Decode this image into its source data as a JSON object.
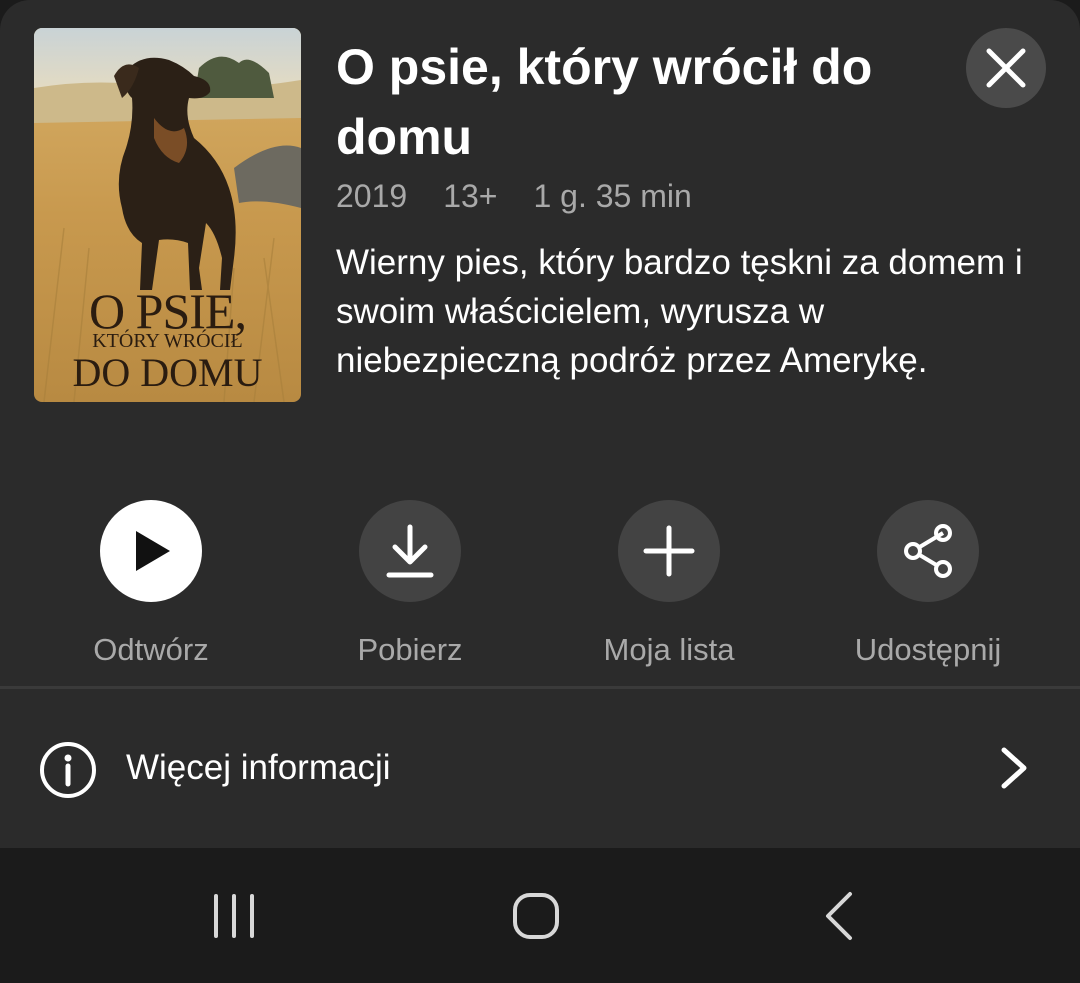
{
  "poster": {
    "line1": "O PSIE,",
    "line2": "KTÓRY WRÓCIŁ",
    "line3": "DO DOMU"
  },
  "title": "O psie, który wrócił do domu",
  "meta": {
    "year": "2019",
    "rating": "13+",
    "duration": "1 g. 35 min"
  },
  "description": "Wierny pies, który bardzo tęskni za domem i swoim właścicielem, wyrusza w niebezpieczną podróż przez Amerykę.",
  "actions": [
    {
      "label": "Odtwórz",
      "icon": "play-icon"
    },
    {
      "label": "Pobierz",
      "icon": "download-icon"
    },
    {
      "label": "Moja lista",
      "icon": "plus-icon"
    },
    {
      "label": "Udostępnij",
      "icon": "share-icon"
    }
  ],
  "more_info": {
    "label": "Więcej informacji",
    "icon": "info-icon"
  },
  "colors": {
    "sheet_bg": "#2b2b2b",
    "nav_bg": "#1b1b1b",
    "button_bg": "#434343",
    "secondary_text": "#a9a9a9"
  }
}
